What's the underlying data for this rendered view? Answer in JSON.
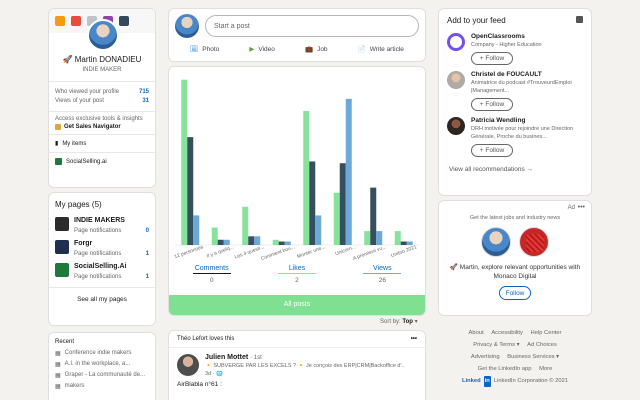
{
  "profile": {
    "extension_icons": [
      {
        "name": "m-extension-icon",
        "color": "#f39c12"
      },
      {
        "name": "fire-extension-icon",
        "color": "#e74c3c"
      },
      {
        "name": "puzzle-extension-icon",
        "color": "#bdc3c7"
      },
      {
        "name": "in-extension-icon",
        "color": "#8e44ad"
      },
      {
        "name": "calendar-extension-icon",
        "color": "#34495e"
      }
    ],
    "name": "🚀 Martin DONADIEU",
    "headline": "INDIE MAKER",
    "stats": [
      {
        "label": "Who viewed your profile",
        "value": "715"
      },
      {
        "label": "Views of your post",
        "value": "31"
      }
    ],
    "premium_text": "Access exclusive tools & insights",
    "premium_link": "Get Sales Navigator",
    "my_items": "My items",
    "socialselling": "SocialSelling.ai"
  },
  "my_pages": {
    "title": "My pages (5)",
    "items": [
      {
        "name": "INDIE MAKERS",
        "notif_label": "Page notifications",
        "count": "0",
        "color": "#2b2b2b"
      },
      {
        "name": "Forgr",
        "notif_label": "Page notifications",
        "count": "1",
        "color": "#1f2f4f"
      },
      {
        "name": "SocialSelling.Ai",
        "notif_label": "Page notifications",
        "count": "1",
        "color": "#1b7a3c"
      }
    ],
    "see_all": "See all my pages"
  },
  "recent": {
    "title": "Recent",
    "items": [
      "Conference indie makers",
      "A.I. in the workplace, a...",
      "Graper - La communauté de...",
      "makers"
    ]
  },
  "start_post": {
    "placeholder": "Start a post",
    "actions": [
      {
        "label": "Photo",
        "icon": "photo-icon",
        "color": "#378fe9"
      },
      {
        "label": "Video",
        "icon": "video-icon",
        "color": "#5f9b41"
      },
      {
        "label": "Job",
        "icon": "job-icon",
        "color": "#a872e8"
      },
      {
        "label": "Write article",
        "icon": "article-icon",
        "color": "#e16745"
      }
    ]
  },
  "chart_data": {
    "type": "bar",
    "categories": [
      "12 personnes",
      "Il y a quelq...",
      "Les 4 questi...",
      "Comment bou...",
      "Monter une...",
      "Unicorn...",
      "A premiere vu...",
      "Unitoo 2021"
    ],
    "series": [
      {
        "name": "Comments",
        "color": "#86e399",
        "values": [
          95,
          10,
          22,
          3,
          77,
          30,
          8,
          8
        ]
      },
      {
        "name": "Likes",
        "color": "#364f5c",
        "values": [
          62,
          3,
          5,
          2,
          48,
          47,
          33,
          2
        ]
      },
      {
        "name": "Views",
        "color": "#6ca9d9",
        "values": [
          17,
          3,
          5,
          2,
          17,
          84,
          8,
          2
        ]
      }
    ],
    "ylim": [
      0,
      100
    ]
  },
  "tabs": [
    {
      "label": "Comments",
      "count": "0",
      "color": "#191919"
    },
    {
      "label": "Likes",
      "count": "2",
      "color": "#86e399"
    },
    {
      "label": "Views",
      "count": "26",
      "color": "#6ca9d9"
    }
  ],
  "all_posts": "All posts",
  "sort_by": {
    "label": "Sort by:",
    "value": "Top"
  },
  "feed": {
    "header": "Théo Lefort loves this",
    "author": "Julien Mottet",
    "degree": "· 1st",
    "subtitle": "🔸 SUBVERGE PAR LES EXCELS ? 🔸 Je conçois des ERP|CRM|Backoffice d'...",
    "time": "3d · 🌐",
    "content": "AirBlabla n°61 :"
  },
  "add_feed": {
    "title": "Add to your feed",
    "items": [
      {
        "name": "OpenClassrooms",
        "desc": "Company - Higher Education",
        "logo_color": "#7451eb",
        "follow": "+ Follow"
      },
      {
        "name": "Christel de FOUCAULT",
        "desc": "Animatrice du podcast #TrouveurdEmploi |Management...",
        "logo_color": "#b0aaa5",
        "follow": "+ Follow"
      },
      {
        "name": "Patricia Wendling",
        "desc": "DRH motivée pour rejoindre une Direction Générale, Proche du busines...",
        "logo_color": "#4b3a32",
        "follow": "+ Follow"
      }
    ],
    "view_all": "View all recommendations →"
  },
  "ad": {
    "tag": "Ad",
    "headline": "Get the latest jobs and industry news",
    "text": "🚀 Martin, explore relevant opportunities with Monaco Digital",
    "button": "Follow"
  },
  "footer": {
    "rows": [
      [
        "About",
        "Accessibility",
        "Help Center"
      ],
      [
        "Privacy & Terms ▾",
        "Ad Choices"
      ],
      [
        "Advertising",
        "Business Services ▾"
      ],
      [
        "Get the LinkedIn app",
        "More"
      ]
    ],
    "brand": "Linked",
    "brand_in": "in",
    "copyright": "LinkedIn Corporation © 2021"
  }
}
